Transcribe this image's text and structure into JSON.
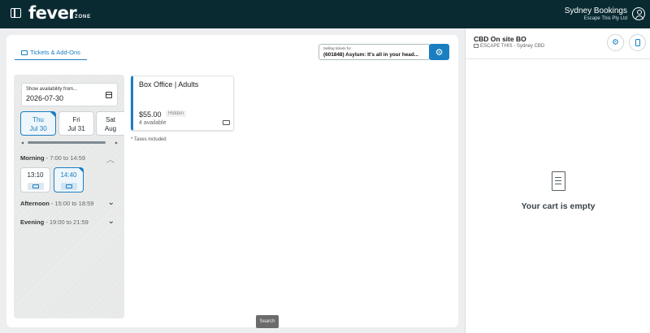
{
  "topbar": {
    "logo": "fever",
    "logo_suffix": "ZONE",
    "account_name": "Sydney Bookings",
    "account_company": "Escape This Pty Ltd"
  },
  "main": {
    "tab_label": "Tickets & Add-Ons",
    "selling_label": "Selling tickets for",
    "selling_value": "(601848) Asylum: It's all in your head...",
    "availability": {
      "date_label": "Show availability from...",
      "date_value": "2026-07-30",
      "days": [
        {
          "name": "Thu",
          "date": "Jul 30"
        },
        {
          "name": "Fri",
          "date": "Jul 31"
        },
        {
          "name": "Sat",
          "date": "Aug"
        }
      ],
      "sections": [
        {
          "name": "Morning",
          "range": " - 7:00 to 14:59"
        },
        {
          "name": "Afternoon",
          "range": " - 15:00 to 18:59"
        },
        {
          "name": "Evening",
          "range": " - 19:00 to 21:59"
        }
      ],
      "slots": [
        {
          "time": "13:10"
        },
        {
          "time": "14:40"
        }
      ]
    },
    "product": {
      "name": "Box Office | Adults",
      "price": "$55.00",
      "tag": "Hidden",
      "availability": "4 available"
    },
    "taxes_note": "* Taxes included",
    "search_label": "Search"
  },
  "cart": {
    "title": "CBD On site BO",
    "subtitle": "ESCAPE THIS - Sydney CBD",
    "empty_text": "Your cart is empty"
  },
  "colors": {
    "topbar": "#0a2a32",
    "accent": "#1a7fc1"
  }
}
